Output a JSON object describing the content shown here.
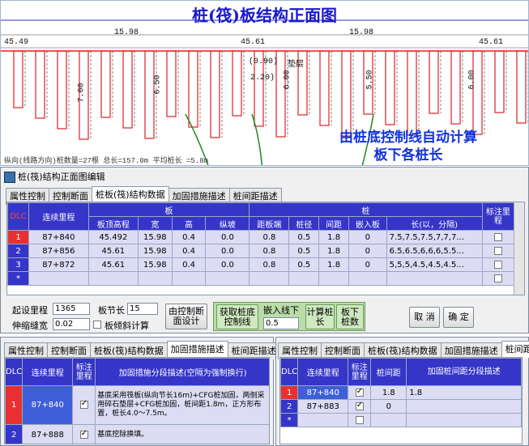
{
  "drawing": {
    "title": "桩(筏)板结构正面图",
    "top_dims": [
      "15.98",
      "15.98"
    ],
    "elevations": [
      "45.49",
      "45.61",
      "45.61"
    ],
    "annotations": [
      "(0.90)",
      "2.20)",
      "垫层"
    ],
    "pile_lengths": [
      "7.00",
      "6.50",
      "6.00",
      "5.50",
      "6.00"
    ],
    "summary": "纵向(线路方向)桩数量=27根 总长=157.0m 平均桩长 =5.8m",
    "overlay_note": [
      "由桩底控制线自动计算",
      "板下各桩长"
    ],
    "colors": {
      "pile": "#e02020",
      "title": "#1a1acc",
      "arrow": "#2e8b2e",
      "note": "#1133dd"
    }
  },
  "dialog": {
    "title": "桩(筏)结构正面图编辑",
    "tabs": [
      "属性控制",
      "控制断面",
      "桩板(筏)结构数据",
      "加固措施描述",
      "桩间距描述"
    ],
    "active_tab": 2,
    "table": {
      "group_headers": {
        "dlc": "DLC",
        "mileage": "连续里程",
        "slab": "板",
        "pile": "桩",
        "mark": "标注里程"
      },
      "columns": [
        "板顶高程",
        "宽",
        "高",
        "纵坡",
        "距板端",
        "桩径",
        "间距",
        "嵌入板",
        "长(以，分隔)"
      ],
      "rows": [
        {
          "dlc": "1",
          "mileage": "87+840",
          "cells": [
            "45.492",
            "15.98",
            "0.4",
            "0.0",
            "0.8",
            "0.5",
            "1.8",
            "0",
            "7.5,7.5,7.5,7,7,7..."
          ],
          "checked": false
        },
        {
          "dlc": "2",
          "mileage": "87+856",
          "cells": [
            "45.61",
            "15.98",
            "0.4",
            "0.0",
            "0.8",
            "0.5",
            "1.8",
            "0",
            "6.5,6.5,6,6,6,5.5..."
          ],
          "checked": false
        },
        {
          "dlc": "3",
          "mileage": "87+872",
          "cells": [
            "45.61",
            "15.98",
            "0.4",
            "0.0",
            "0.8",
            "0.5",
            "1.8",
            "0",
            "5,5,5,4.5,4.5,4.5..."
          ],
          "checked": false
        },
        {
          "dlc": "*",
          "mileage": "",
          "cells": [
            "",
            "",
            "",
            "",
            "",
            "",
            "",
            "",
            ""
          ],
          "checked": false
        }
      ]
    },
    "controls": {
      "start_mileage_label": "起设里程",
      "start_mileage_value": "1365",
      "segment_label": "板节长",
      "segment_value": "15",
      "gap_label": "伸缩缝宽",
      "gap_value": "0.02",
      "tilt_label": "板倾斜计算",
      "btn_design": "由控制断面设计",
      "btn_get_line": "获取桩底控制线",
      "embed_label": "嵌入线下",
      "embed_value": "0.5",
      "btn_calc_len": "计算桩长",
      "btn_pile_count": "板下桩数",
      "btn_cancel": "取 消",
      "btn_ok": "确 定"
    }
  },
  "panel_left": {
    "tabs": [
      "属性控制",
      "控制断面",
      "桩板(筏)结构数据",
      "加固措施描述",
      "桩间距描述"
    ],
    "active_tab": 3,
    "headers": [
      "DLC",
      "连续里程",
      "标注里程",
      "加固措施分段描述(空隔为强制换行)"
    ],
    "rows": [
      {
        "dlc": "1",
        "mileage": "87+840",
        "checked": true,
        "desc": "基底采用筏板(纵向节长16m)+CFG桩加固，两侧采用碎石垫层+CFG桩加固，桩间距1.8m，正方形布置，桩长4.0～7.5m。"
      },
      {
        "dlc": "2",
        "mileage": "87+888",
        "checked": true,
        "desc": "基底挖除换填。"
      }
    ]
  },
  "panel_right": {
    "tabs": [
      "属性控制",
      "控制断面",
      "桩板(筏)结构数据",
      "加固措施描述",
      "桩间距描述"
    ],
    "active_tab": 4,
    "headers": [
      "DLC",
      "连续里程",
      "标注里程",
      "桩间距",
      "加固桩间距分段描述"
    ],
    "rows": [
      {
        "dlc": "1",
        "mileage": "87+840",
        "checked": true,
        "spacing": "1.8",
        "desc": "1.8"
      },
      {
        "dlc": "2",
        "mileage": "87+883",
        "checked": true,
        "spacing": "0",
        "desc": ""
      },
      {
        "dlc": "*",
        "mileage": "",
        "checked": false,
        "spacing": "",
        "desc": ""
      }
    ]
  }
}
